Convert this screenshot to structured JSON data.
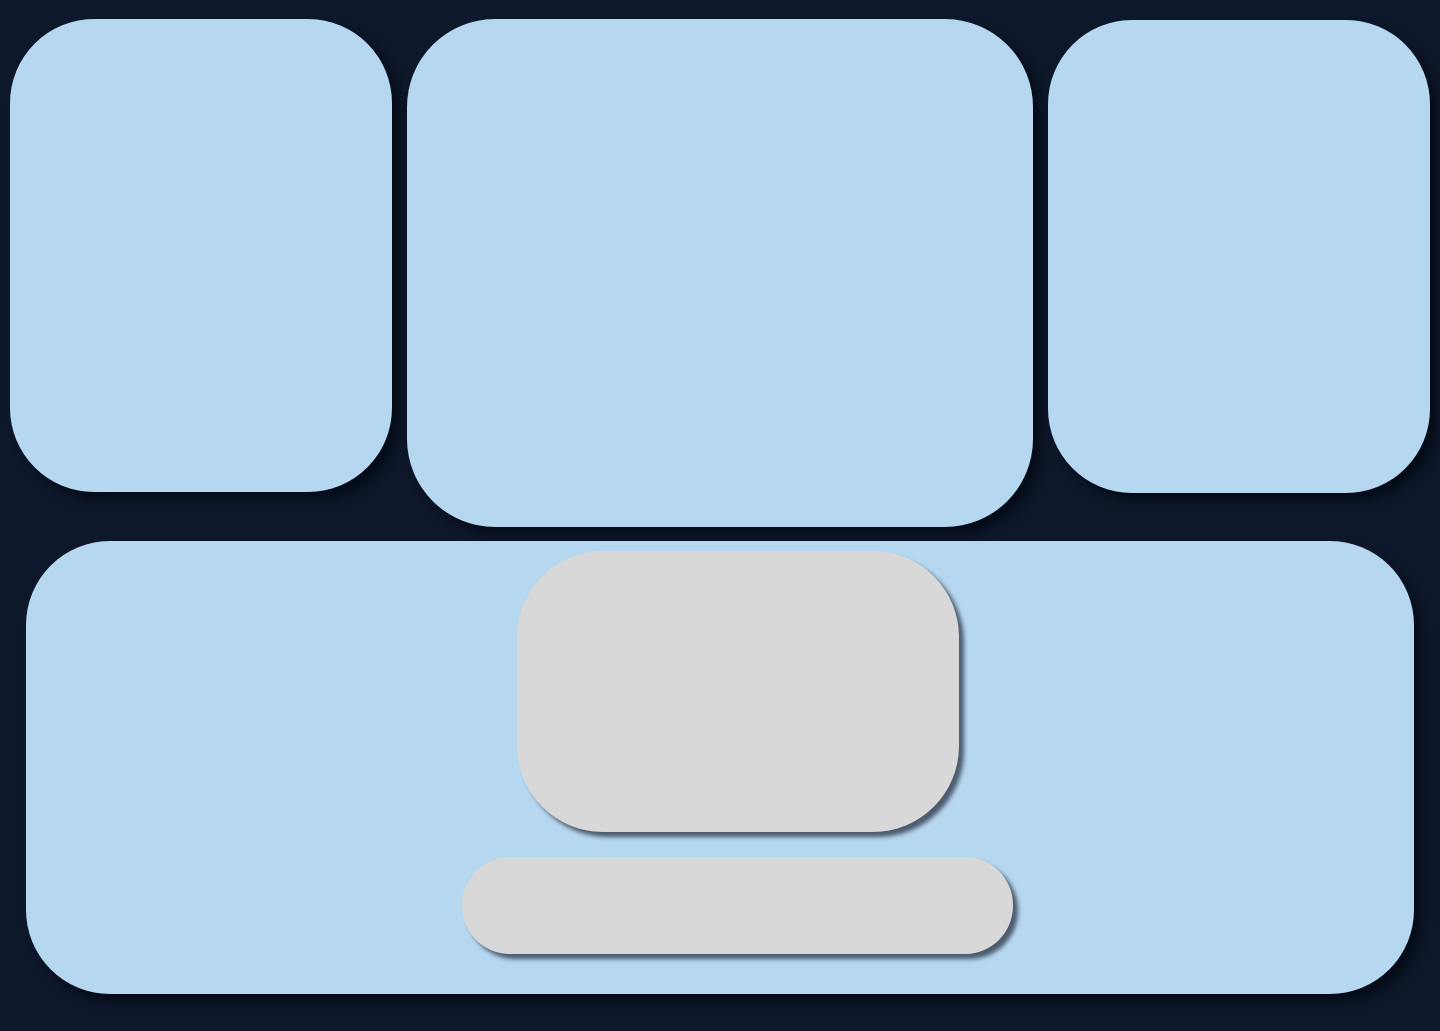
{
  "colors": {
    "background": "#0e182b",
    "panel": "#b5d7ef",
    "block": "#d8d8d8"
  },
  "panels": {
    "left": {},
    "center": {},
    "right": {},
    "bottom": {
      "preview_block": {},
      "bar_block": {}
    }
  }
}
